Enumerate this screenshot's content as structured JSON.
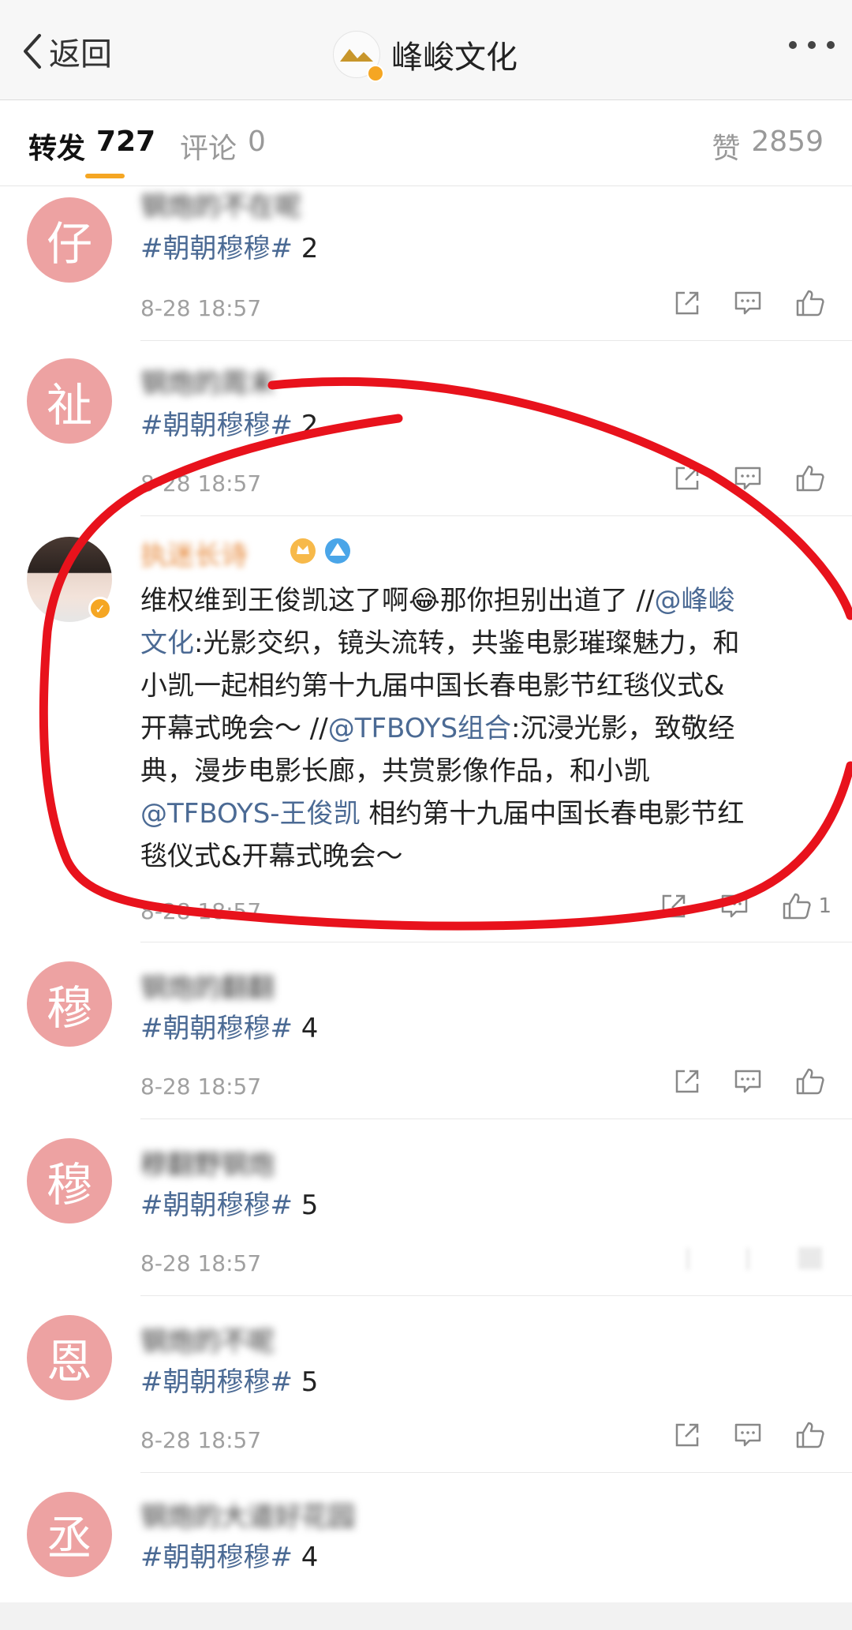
{
  "nav": {
    "back_label": "返回",
    "title": "峰峻文化"
  },
  "tabs": {
    "repost_label": "转发",
    "repost_count": "727",
    "comment_label": "评论",
    "comment_count": "0",
    "like_label": "赞",
    "like_count": "2859"
  },
  "reposts": [
    {
      "avatar_char": "仔",
      "username": "钢炮的不在呢",
      "topic": "#朝朝穆穆#",
      "text": " 2",
      "time": "8-28 18:57"
    },
    {
      "avatar_char": "祉",
      "username": "钢炮的周末",
      "topic": "#朝朝穆穆#",
      "text": " 2",
      "time": "8-28 18:57"
    },
    {
      "username": "执迷长诗",
      "lines": [
        [
          "维权维到王俊凯这了啊",
          "😂",
          "那你担别出道了 //",
          "@峰峻"
        ],
        [
          "文化",
          ":光影交织，镜头流转，共鉴电影璀璨魅力，和"
        ],
        [
          "小凯一起相约第十九届中国长春电影节红毯仪式&"
        ],
        [
          "开幕式晚会～ //",
          "@TFBOYS组合",
          ":沉浸光影，致敬经"
        ],
        [
          "典，漫步电影长廊，共赏影像作品，和小凯"
        ],
        [
          "@TFBOYS-王俊凯",
          " 相约第十九届中国长春电影节红"
        ],
        [
          "毯仪式&开幕式晚会～"
        ]
      ],
      "time": "8-28 18:57",
      "like_count": "1"
    },
    {
      "avatar_char": "穆",
      "username": "钢炮的翻翻",
      "topic": "#朝朝穆穆#",
      "text": " 4",
      "time": "8-28 18:57"
    },
    {
      "avatar_char": "穆",
      "username": "穆翻野钢炮",
      "topic": "#朝朝穆穆#",
      "text": " 5",
      "time": "8-28 18:57"
    },
    {
      "avatar_char": "恩",
      "username": "钢炮的不呢",
      "topic": "#朝朝穆穆#",
      "text": " 5",
      "time": "8-28 18:57"
    },
    {
      "avatar_char": "丞",
      "username": "钢炮的大道好花园",
      "topic": "#朝朝穆穆#",
      "text": " 4"
    }
  ],
  "icons": {
    "share": "share-icon",
    "comment": "comment-icon",
    "like": "thumbs-up-icon"
  },
  "colors": {
    "topic_link": "#4b6a94",
    "avatar_bg": "#eda2a2",
    "accent": "#f5a623",
    "annotation": "#e8121c"
  }
}
